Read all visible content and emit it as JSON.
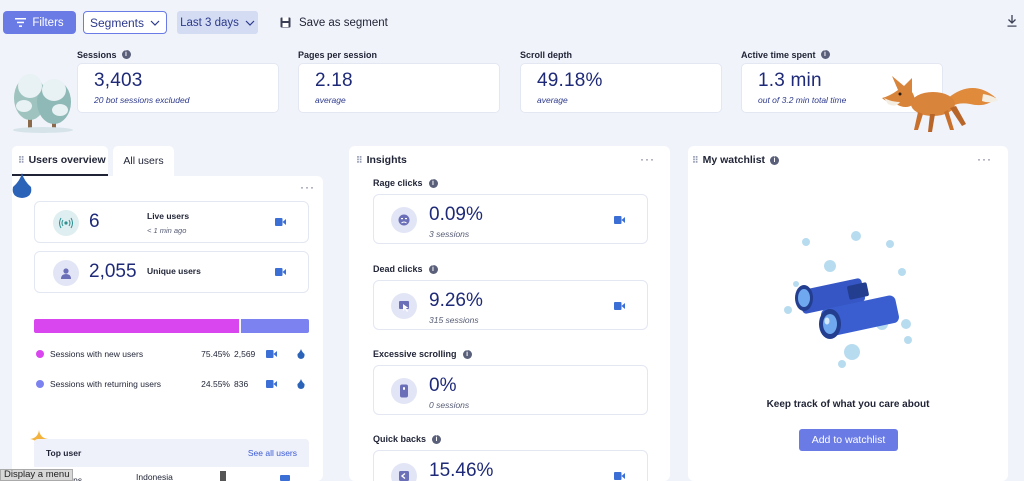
{
  "toolbar": {
    "filters_label": "Filters",
    "segments_label": "Segments",
    "date_range_label": "Last 3 days",
    "save_segment_label": "Save as segment"
  },
  "stats": [
    {
      "label": "Sessions",
      "value": "3,403",
      "sub": "20 bot sessions excluded",
      "info": true
    },
    {
      "label": "Pages per session",
      "value": "2.18",
      "sub": "average",
      "info": false
    },
    {
      "label": "Scroll depth",
      "value": "49.18%",
      "sub": "average",
      "info": false
    },
    {
      "label": "Active time spent",
      "value": "1.3 min",
      "sub": "out of 3.2 min total time",
      "info": true
    }
  ],
  "users_panel": {
    "tab_active": "Users overview",
    "tab_inactive": "All users",
    "live_users_value": "6",
    "live_users_label": "Live users",
    "live_users_time": "< 1 min ago",
    "unique_users_value": "2,055",
    "unique_users_label": "Unique users",
    "bar_new_fraction": 0.7545,
    "sessions": [
      {
        "label": "Sessions with new users",
        "percent": "75.45%",
        "count": "2,569",
        "color": "#d946ef"
      },
      {
        "label": "Sessions with returning users",
        "percent": "24.55%",
        "count": "836",
        "color": "#7c83f0"
      }
    ],
    "top_user_title": "Top user",
    "see_all_label": "See all users",
    "row_partial_left": "ssions",
    "row_partial_country": "Indonesia"
  },
  "insights_panel": {
    "title": "Insights",
    "items": [
      {
        "label": "Rage clicks",
        "value": "0.09%",
        "sub": "3 sessions"
      },
      {
        "label": "Dead clicks",
        "value": "9.26%",
        "sub": "315 sessions"
      },
      {
        "label": "Excessive scrolling",
        "value": "0%",
        "sub": "0 sessions"
      },
      {
        "label": "Quick backs",
        "value": "15.46%",
        "sub": ""
      }
    ]
  },
  "watchlist_panel": {
    "title": "My watchlist",
    "message": "Keep track of what you care about",
    "button_label": "Add to watchlist"
  },
  "tooltip_text": "Display a menu",
  "colors": {
    "accent": "#6b7be6",
    "value_text": "#1e2a78",
    "new_users": "#d946ef",
    "returning_users": "#7c83f0",
    "video_icon": "#3b6fd6",
    "background": "#f0f3fa"
  }
}
